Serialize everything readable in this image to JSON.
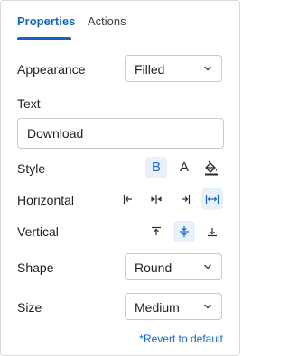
{
  "tabs": [
    {
      "label": "Properties",
      "active": true
    },
    {
      "label": "Actions",
      "active": false
    }
  ],
  "appearance": {
    "label": "Appearance",
    "value": "Filled"
  },
  "text": {
    "label": "Text",
    "value": "Download"
  },
  "style": {
    "label": "Style",
    "buttons": [
      {
        "name": "bold",
        "glyph": "B",
        "selected": true
      },
      {
        "name": "text-color",
        "glyph": "A",
        "selected": false
      },
      {
        "name": "fill-color",
        "icon": "paint-bucket-icon",
        "selected": false
      }
    ]
  },
  "horizontal": {
    "label": "Horizontal",
    "buttons": [
      {
        "name": "align-left",
        "icon": "align-left-icon",
        "selected": false
      },
      {
        "name": "align-center",
        "icon": "align-center-horizontal-icon",
        "selected": false
      },
      {
        "name": "align-right",
        "icon": "align-right-icon",
        "selected": false
      },
      {
        "name": "stretch",
        "icon": "stretch-horizontal-icon",
        "selected": true
      }
    ]
  },
  "vertical": {
    "label": "Vertical",
    "buttons": [
      {
        "name": "align-top",
        "icon": "align-top-icon",
        "selected": false
      },
      {
        "name": "align-middle",
        "icon": "align-middle-icon",
        "selected": true
      },
      {
        "name": "align-bottom",
        "icon": "align-bottom-icon",
        "selected": false
      }
    ]
  },
  "shape": {
    "label": "Shape",
    "value": "Round"
  },
  "size": {
    "label": "Size",
    "value": "Medium"
  },
  "revert_label": "*Revert to default",
  "colors": {
    "accent": "#1565c0",
    "selected_bg": "#e8f1fb",
    "border": "#c9c9c9"
  }
}
